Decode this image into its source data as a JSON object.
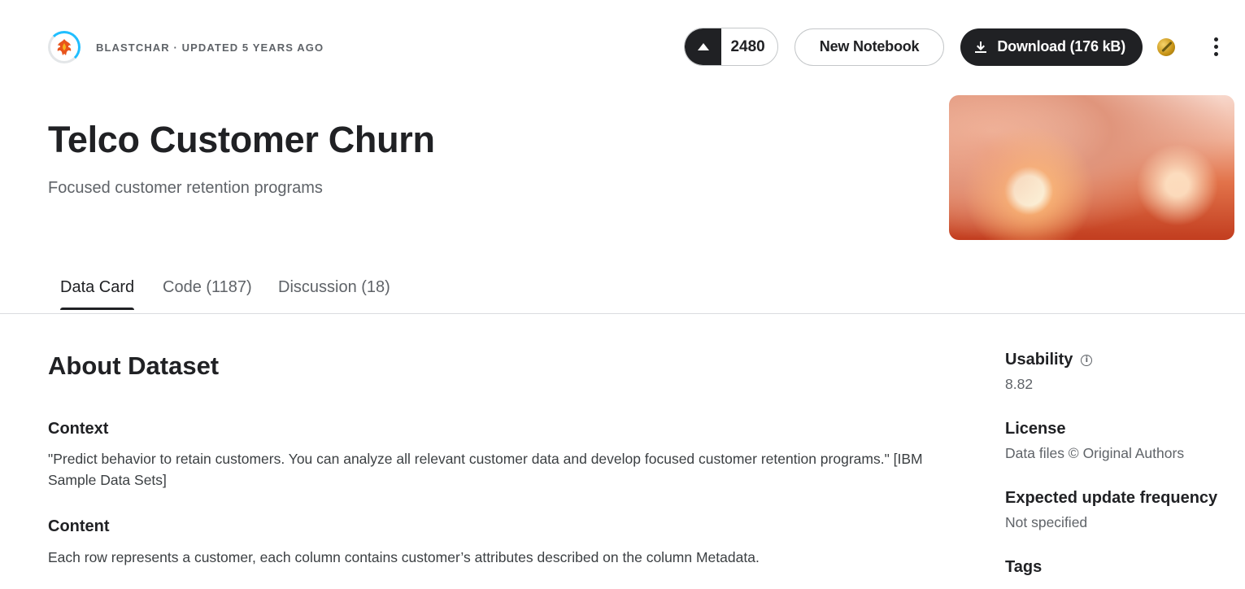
{
  "owner": {
    "meta": "BLASTCHAR · UPDATED 5 YEARS AGO"
  },
  "actions": {
    "vote_count": "2480",
    "new_notebook_label": "New Notebook",
    "download_label": "Download (176 kB)"
  },
  "dataset": {
    "title": "Telco Customer Churn",
    "subtitle": "Focused customer retention programs"
  },
  "tabs": [
    {
      "label": "Data Card",
      "active": true
    },
    {
      "label": "Code (1187)",
      "active": false
    },
    {
      "label": "Discussion (18)",
      "active": false
    }
  ],
  "about": {
    "heading": "About Dataset",
    "context_heading": "Context",
    "context_text": "\"Predict behavior to retain customers. You can analyze all relevant customer data and develop focused customer retention programs.\" [IBM Sample Data Sets]",
    "content_heading": "Content",
    "content_text": "Each row represents a customer, each column contains customer’s attributes described on the column Metadata."
  },
  "sidebar": {
    "usability_label": "Usability",
    "usability_value": "8.82",
    "license_label": "License",
    "license_value": "Data files © Original Authors",
    "update_label": "Expected update frequency",
    "update_value": "Not specified",
    "tags_label": "Tags"
  },
  "icons": {
    "avatar": "phoenix-avatar-icon",
    "vote": "upvote-arrow-icon",
    "download": "download-icon",
    "medal": "gold-medal-icon",
    "more": "more-vertical-icon",
    "info": "info-icon"
  },
  "colors": {
    "primary_dark": "#202124",
    "text_secondary": "#5f6368",
    "border": "#dadce0",
    "accent_blue": "#20beff",
    "medal_gold": "#c69214"
  }
}
